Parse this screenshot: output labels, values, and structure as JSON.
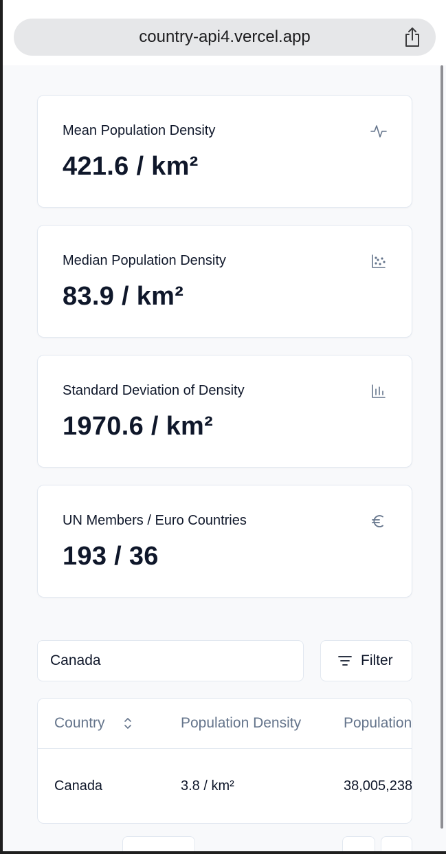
{
  "browser": {
    "url": "country-api4.vercel.app",
    "share_icon": "share-icon"
  },
  "stats": [
    {
      "title": "Mean Population Density",
      "value": "421.6 / km²",
      "icon": "activity-icon"
    },
    {
      "title": "Median Population Density",
      "value": "83.9 / km²",
      "icon": "scatter-chart-icon"
    },
    {
      "title": "Standard Deviation of Density",
      "value": "1970.6 / km²",
      "icon": "bar-chart-icon"
    },
    {
      "title": "UN Members / Euro Countries",
      "value": "193 / 36",
      "icon": "euro-icon"
    }
  ],
  "search": {
    "value": "Canada"
  },
  "filter": {
    "label": "Filter",
    "icon": "filter-icon"
  },
  "table": {
    "columns": [
      "Country",
      "Population Density",
      "Population"
    ],
    "rows": [
      [
        "Canada",
        "3.8 / km²",
        "38,005,238"
      ]
    ]
  }
}
